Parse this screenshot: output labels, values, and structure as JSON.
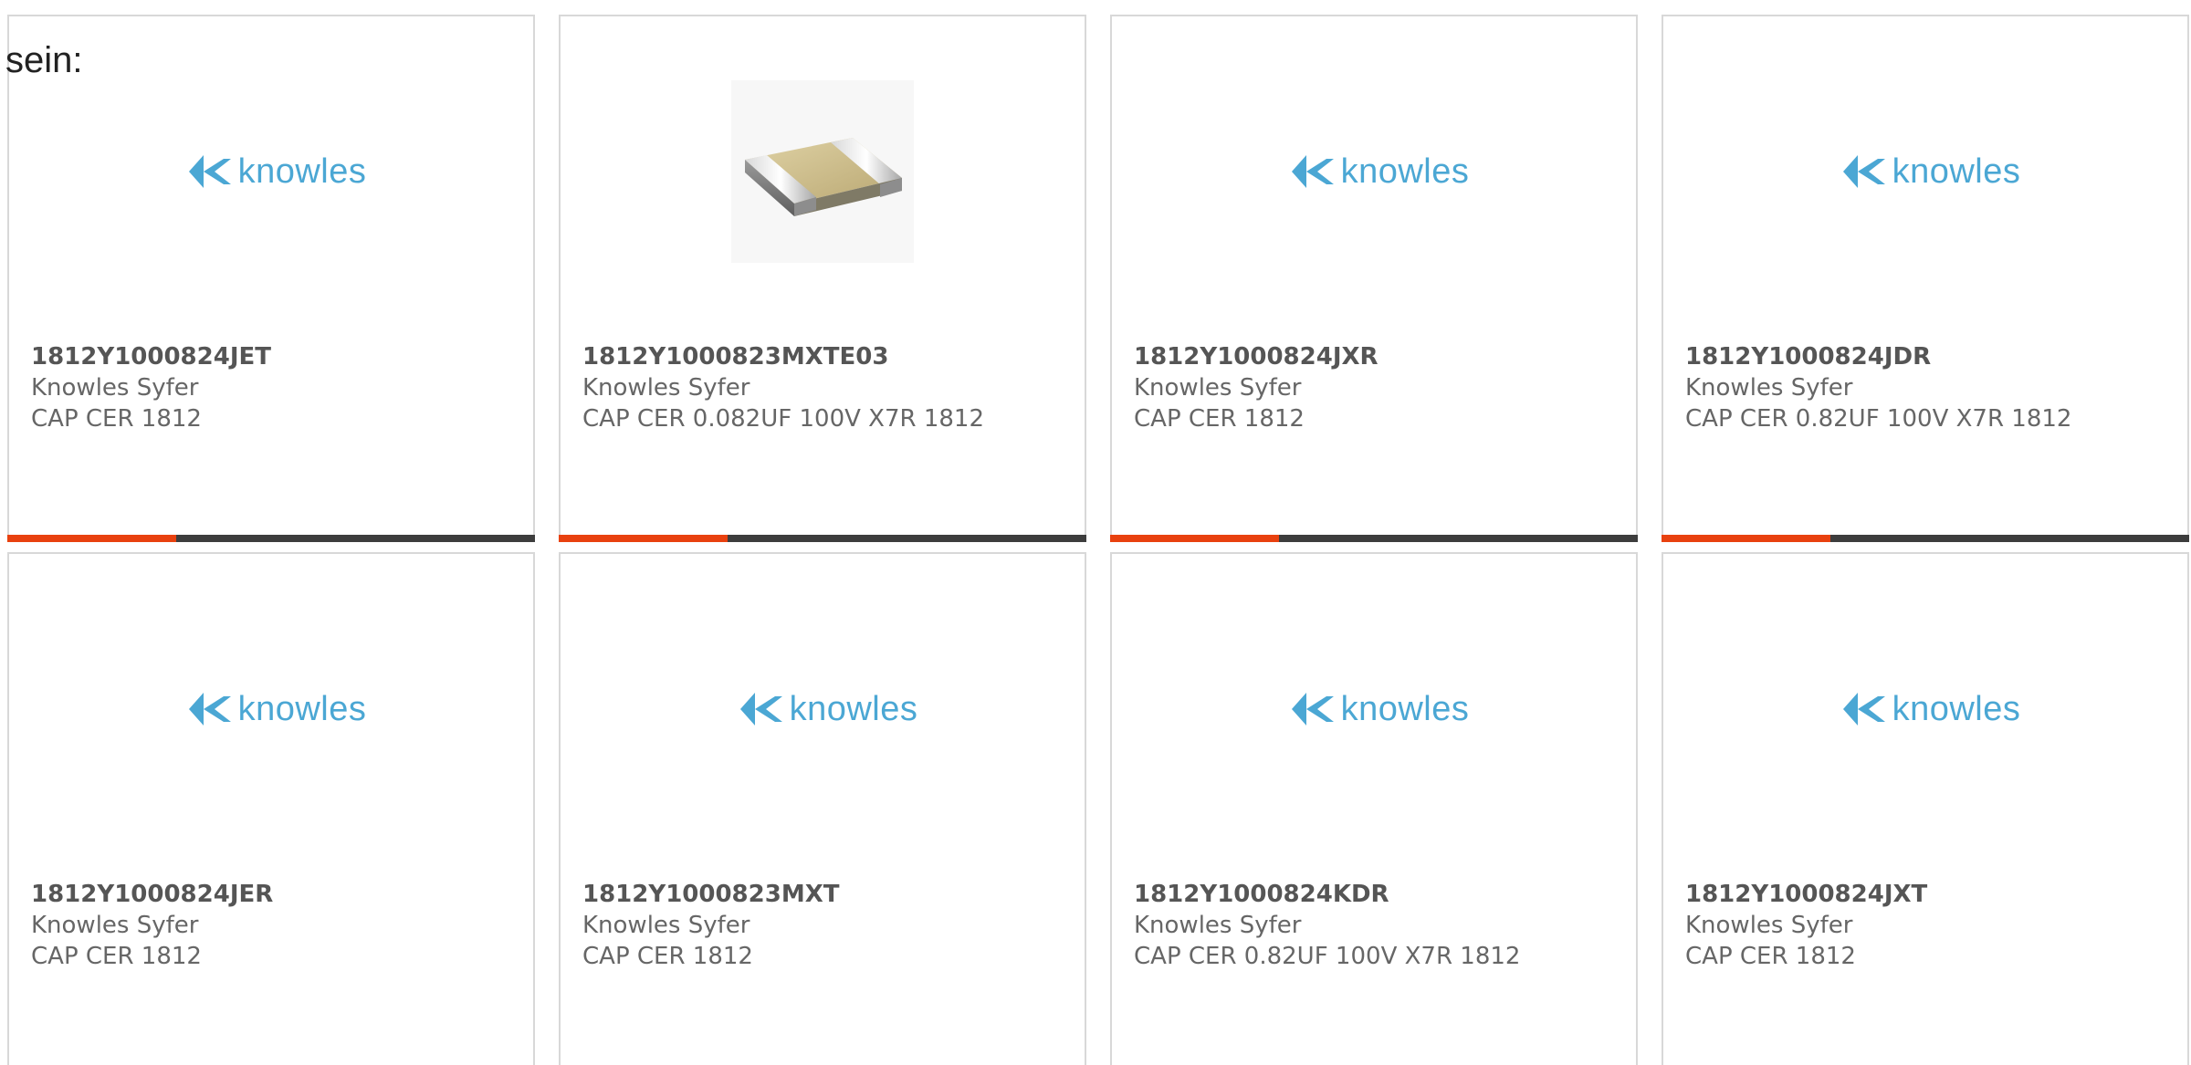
{
  "intro": {
    "text": "sein:"
  },
  "colors": {
    "brand_logo": "#4ba7d4",
    "progress_accent": "#e8410f",
    "progress_track": "#3d3d3d",
    "card_border": "#d8d8d8"
  },
  "logo": {
    "text": "knowles",
    "icon": "knowles-logo-icon"
  },
  "products": [
    {
      "part_number": "1812Y1000824JET",
      "manufacturer": "Knowles Syfer",
      "description": "CAP CER 1812",
      "image": "knowles-logo",
      "progress": 0.32
    },
    {
      "part_number": "1812Y1000823MXTE03",
      "manufacturer": "Knowles Syfer",
      "description": "CAP CER 0.082UF 100V X7R 1812",
      "image": "capacitor-chip",
      "progress": 0.32
    },
    {
      "part_number": "1812Y1000824JXR",
      "manufacturer": "Knowles Syfer",
      "description": "CAP CER 1812",
      "image": "knowles-logo",
      "progress": 0.32
    },
    {
      "part_number": "1812Y1000824JDR",
      "manufacturer": "Knowles Syfer",
      "description": "CAP CER 0.82UF 100V X7R 1812",
      "image": "knowles-logo",
      "progress": 0.32
    },
    {
      "part_number": "1812Y1000824JER",
      "manufacturer": "Knowles Syfer",
      "description": "CAP CER 1812",
      "image": "knowles-logo"
    },
    {
      "part_number": "1812Y1000823MXT",
      "manufacturer": "Knowles Syfer",
      "description": "CAP CER 1812",
      "image": "knowles-logo"
    },
    {
      "part_number": "1812Y1000824KDR",
      "manufacturer": "Knowles Syfer",
      "description": "CAP CER 0.82UF 100V X7R 1812",
      "image": "knowles-logo"
    },
    {
      "part_number": "1812Y1000824JXT",
      "manufacturer": "Knowles Syfer",
      "description": "CAP CER 1812",
      "image": "knowles-logo"
    }
  ]
}
